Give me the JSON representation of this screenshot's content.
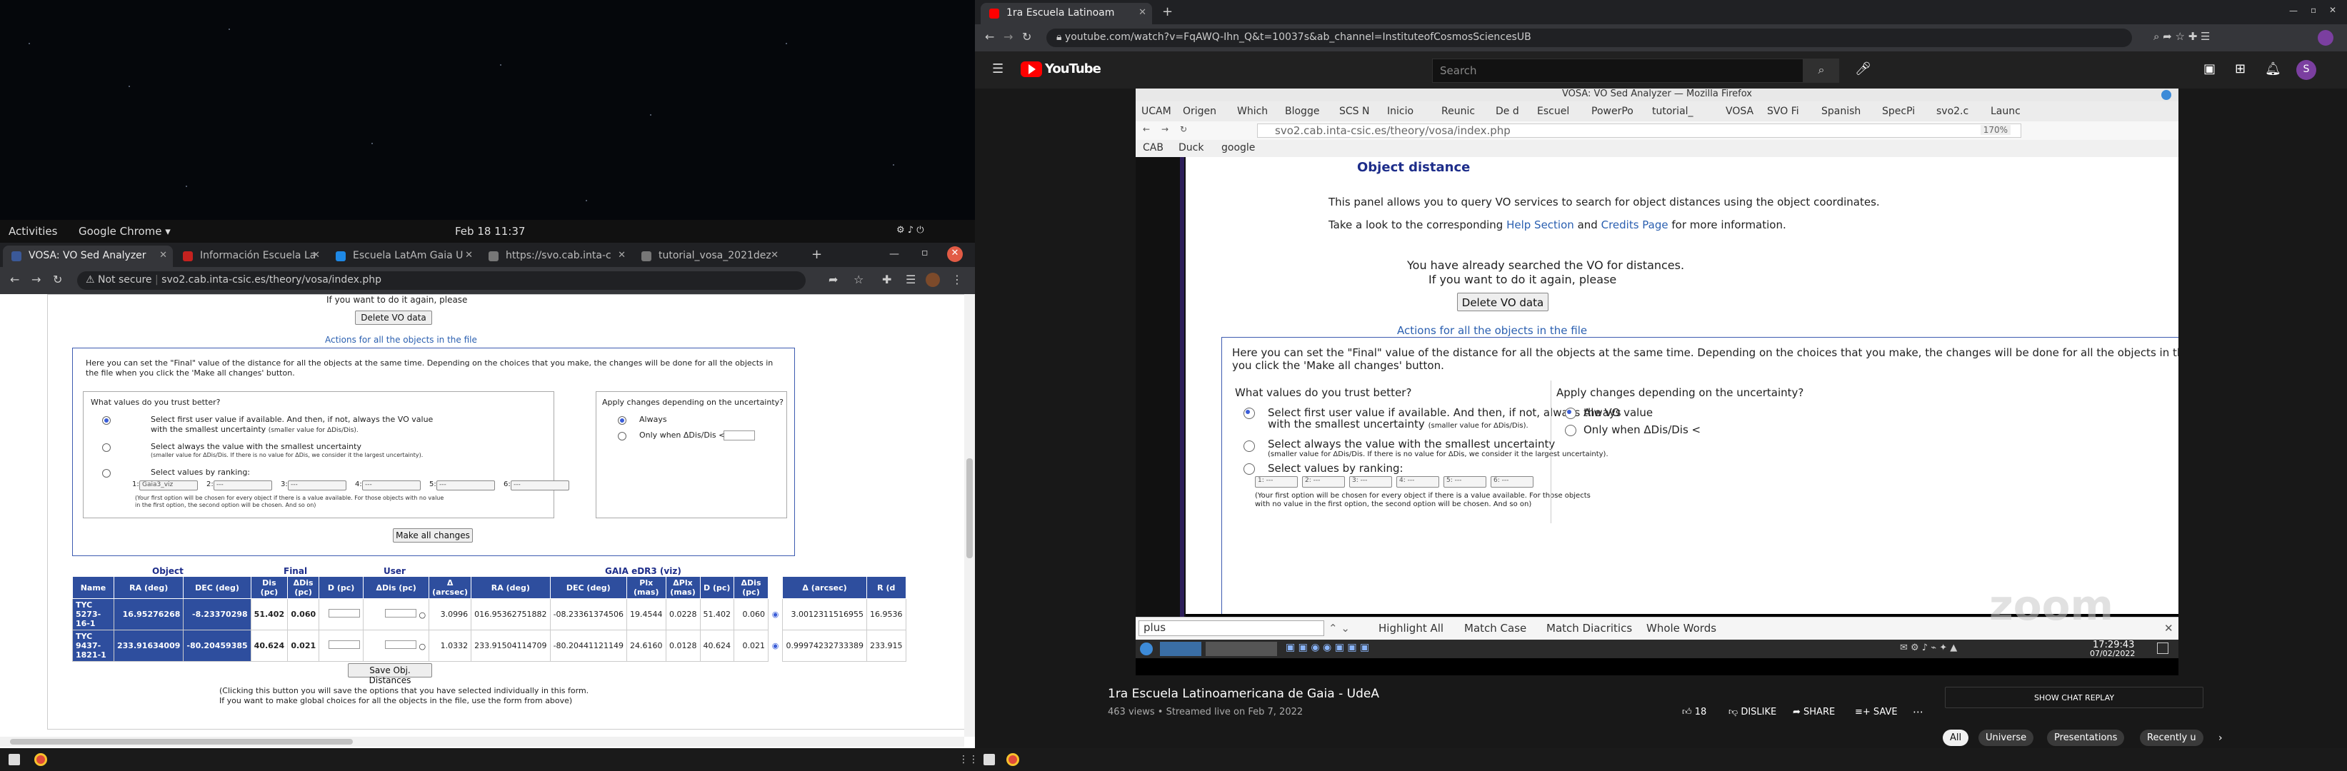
{
  "gnome": {
    "activities": "Activities",
    "app": "Google Chrome ▾",
    "clock": "Feb 18  11:37"
  },
  "left_browser": {
    "tabs": [
      {
        "label": "VOSA: VO Sed Analyzer",
        "color": "#3b5998"
      },
      {
        "label": "Información Escuela La",
        "color": "#c5221f"
      },
      {
        "label": "Escuela LatAm Gaia U",
        "color": "#1e88e5"
      },
      {
        "label": "https://svo.cab.inta-c",
        "color": "#777777"
      },
      {
        "label": "tutorial_vosa_2021dez",
        "color": "#777777"
      }
    ],
    "not_secure": "Not secure",
    "url": "svo2.cab.inta-csic.es/theory/vosa/index.php",
    "page": {
      "top_text": "If you want to do it again, please",
      "delete_btn": "Delete VO data",
      "actions_link": "Actions for all the objects in the file",
      "intro": "Here you can set the \"Final\" value of the distance for all the objects at the same time. Depending on the choices that you make, the changes will be done for all the objects in the file when you click the 'Make all changes' button.",
      "trust_title": "What values do you trust better?",
      "opt1": "Select first user value if available. And then, if not, always the VO value",
      "opt1b": "with the smallest uncertainty",
      "opt1_note": "(smaller value for ΔDis/Dis).",
      "opt2": "Select always the value with the smallest uncertainty",
      "opt2_note": "(smaller value for ΔDis/Dis. If there is no value for ΔDis, we consider it the largest uncertainty).",
      "opt3": "Select values by ranking:",
      "rank1": "Gaia3_viz",
      "rank_blank": "---",
      "rank_note": "(Your first option will be chosen for every object if there is a value available. For those objects with no value in the first option, the second option will be chosen. And so on)",
      "apply_title": "Apply changes depending on the uncertainty?",
      "always": "Always",
      "only_when": "Only when ΔDis/Dis <",
      "make_all": "Make all changes",
      "groups": {
        "object": "Object",
        "final": "Final",
        "user": "User",
        "gaia": "GAIA eDR3 (viz)"
      },
      "headers": [
        "Name",
        "RA (deg)",
        "DEC (deg)",
        "Dis (pc)",
        "ΔDis (pc)",
        "D (pc)",
        "ΔDis (pc)",
        "Δ (arcsec)",
        "RA (deg)",
        "DEC (deg)",
        "Plx (mas)",
        "ΔPlx (mas)",
        "D (pc)",
        "ΔDis (pc)",
        "Δ (arcsec)",
        "R (d"
      ],
      "rows": [
        [
          "TYC 5273-16-1",
          "16.95276268",
          "-8.23370298",
          "51.402",
          "0.060",
          "3.0996",
          "016.95362751882",
          "-08.23361374506",
          "19.4544",
          "0.0228",
          "51.402",
          "0.060",
          "3.0012311516955",
          "16.9536"
        ],
        [
          "TYC 9437-1821-1",
          "233.91634009",
          "-80.20459385",
          "40.624",
          "0.021",
          "1.0332",
          "233.91504114709",
          "-80.20441121149",
          "24.6160",
          "0.0128",
          "40.624",
          "0.021",
          "0.99974232733389",
          "233.915"
        ]
      ],
      "save_btn": "Save Obj. Distances",
      "save_note1": "(Clicking this button you will save the options that you have selected individually in this form.",
      "save_note2": "If you want to make global choices for all the objects in the file, use the form from above)"
    }
  },
  "youtube": {
    "tab_title": "1ra Escuela Latinoam",
    "url": "youtube.com/watch?v=FqAWQ-Ihn_Q&t=10037s&ab_channel=InstituteofCosmosSciencesUB",
    "logo": "YouTube",
    "search_placeholder": "Search",
    "avatar": "S",
    "ff_title": "VOSA: VO Sed Analyzer — Mozilla Firefox",
    "ff_tabs": [
      "UCAM",
      "Origen",
      "Which",
      "Blogge",
      "SCS N",
      "Inicio",
      "Reunic",
      "De d",
      "Escuel",
      "PowerPo",
      "tutorial_",
      "VOSA",
      "SVO Fi",
      "Spanish",
      "SpecPi",
      "svo2.c",
      "Launc"
    ],
    "ff_url": "svo2.cab.inta-csic.es/theory/vosa/index.php",
    "ff_zoom": "170%",
    "bookmarks": [
      "CAB",
      "Duck",
      "google"
    ],
    "vosa": {
      "title": "Object distance",
      "p1": "This panel allows you to query VO services to search for object distances using the object coordinates.",
      "p2_a": "Take a look to the corresponding",
      "help": "Help Section",
      "p2_b": "and",
      "credits": "Credits Page",
      "p2_c": "for more information.",
      "already1": "You have already searched the VO for distances.",
      "already2": "If you want to do it again, please",
      "delete_btn": "Delete VO data",
      "actions": "Actions for all the objects in the file",
      "intro1": "Here you can set the \"Final\" value of the distance for all the objects at the same time. Depending on the choices that you make, the changes will be done for all the objects in the file whe",
      "intro2": "you click the 'Make all changes' button.",
      "trust": "What values do you trust better?",
      "opt1": "Select first user value if available. And then, if not, always the VO value",
      "opt1b": "with the smallest uncertainty",
      "opt1_note": "(smaller value for ΔDis/Dis).",
      "opt2": "Select always the value with the smallest uncertainty",
      "opt2_note": "(smaller value for ΔDis/Dis. If there is no value for ΔDis, we consider it the largest uncertainty).",
      "opt3": "Select values by ranking:",
      "rank_note1": "(Your first option will be chosen for every object if there is a value available. For those objects",
      "rank_note2": "with no value in the first option, the second option will be chosen. And so on)",
      "apply": "Apply changes depending on the uncertainty?",
      "always": "Always",
      "only": "Only when ΔDis/Dis <"
    },
    "find": {
      "value": "plus",
      "highlight": "Highlight All",
      "match_case": "Match Case",
      "diacritics": "Match Diacritics",
      "whole": "Whole Words"
    },
    "xfce_clock": "17:29:43",
    "xfce_date": "07/02/2022",
    "zoom_watermark": "zoom",
    "video_title": "1ra Escuela Latinoamericana de Gaia - UdeA",
    "meta": "463 views • Streamed live on Feb 7, 2022",
    "likes": "18",
    "dislike": "DISLIKE",
    "share": "SHARE",
    "save": "SAVE",
    "chat_replay": "SHOW CHAT REPLAY",
    "chips": [
      "All",
      "Universe",
      "Presentations",
      "Recently u"
    ]
  }
}
